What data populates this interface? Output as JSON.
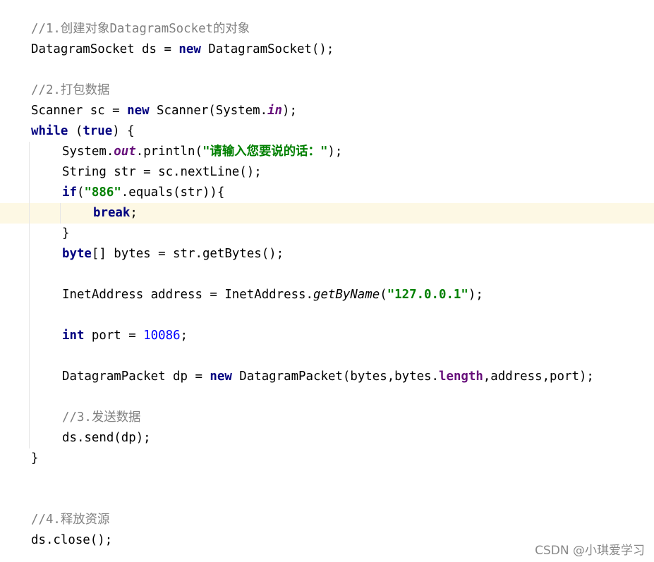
{
  "code": {
    "comment1": "//1.创建对象DatagramSocket的对象",
    "l_ds_decl": "DatagramSocket ds = ",
    "kw_new": "new",
    "l_ds_ctor": " DatagramSocket();",
    "comment2": "//2.打包数据",
    "l_sc_decl": "Scanner sc = ",
    "l_sc_ctor": " Scanner(System.",
    "f_in": "in",
    "l_sc_end": ");",
    "kw_while": "while",
    "l_while_open": " (",
    "kw_true": "true",
    "l_while_close": ") {",
    "l_print_prefix": "System.",
    "f_out": "out",
    "l_print_call": ".println(",
    "s_prompt": "\"请输入您要说的话：\"",
    "l_print_end": ");",
    "l_str": "String str = sc.nextLine();",
    "kw_if": "if",
    "l_if_open": "(",
    "s_886": "\"886\"",
    "l_if_rest": ".equals(str)){",
    "kw_break": "break",
    "l_semicolon": ";",
    "l_close_brace": "}",
    "kw_byte": "byte",
    "l_bytes": "[] bytes = str.getBytes();",
    "l_addr_decl": "InetAddress address = InetAddress.",
    "m_getbyname": "getByName",
    "l_addr_open": "(",
    "s_ip": "\"127.0.0.1\"",
    "l_addr_end": ");",
    "kw_int": "int",
    "l_port": " port = ",
    "n_port": "10086",
    "l_port_end": ";",
    "l_dp_decl": "DatagramPacket dp = ",
    "l_dp_ctor": " DatagramPacket(bytes,bytes.",
    "fi_length": "length",
    "l_dp_end": ",address,port);",
    "comment3": "//3.发送数据",
    "l_send": "ds.send(dp);",
    "l_while_end": "}",
    "comment4": "//4.释放资源",
    "l_close": "ds.close();"
  },
  "watermark": "CSDN @小琪爱学习",
  "colors": {
    "keyword": "#000080",
    "string": "#008000",
    "number": "#0000ff",
    "comment": "#808080",
    "field": "#660e7a",
    "current_line": "#fdf8e4"
  }
}
